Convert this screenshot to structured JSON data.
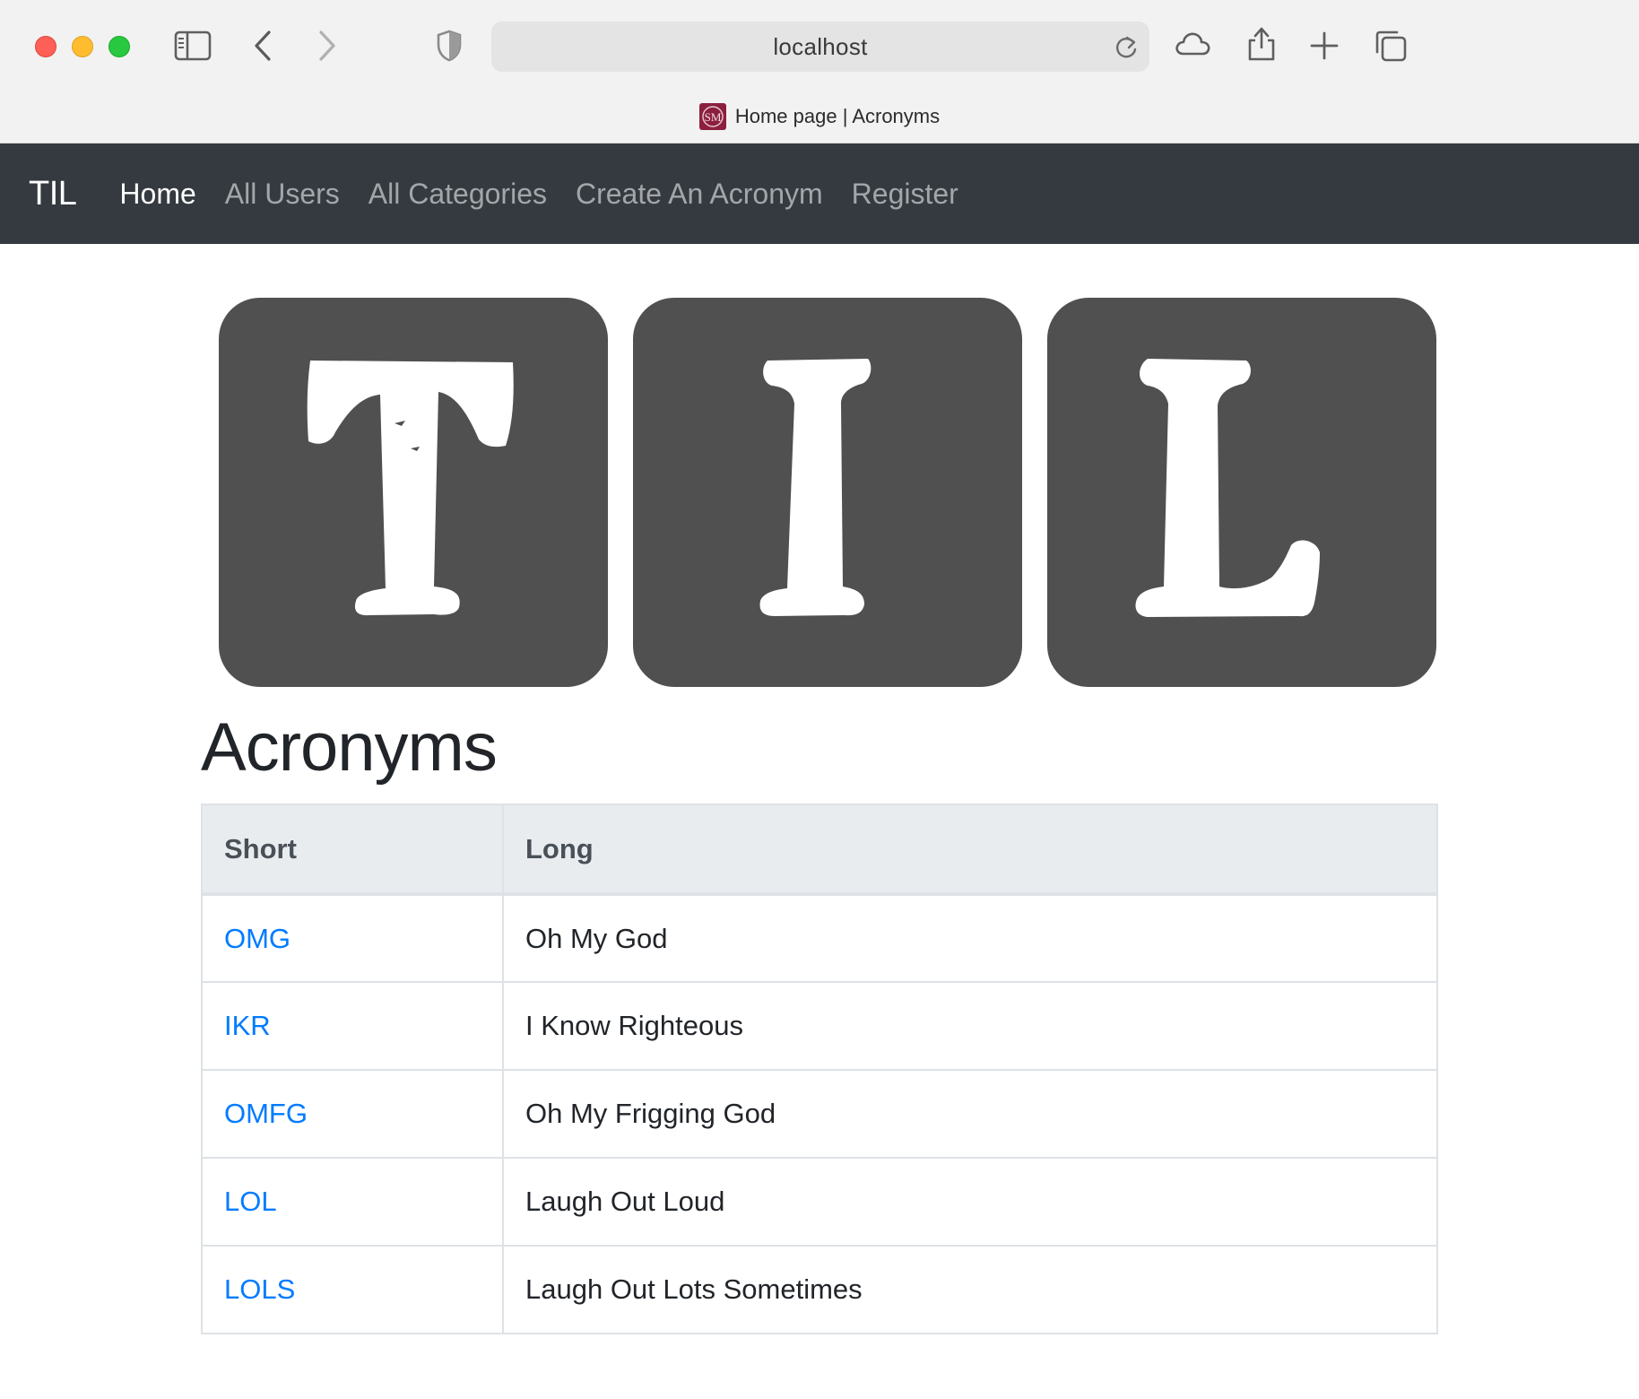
{
  "browser": {
    "url": "localhost",
    "tab_title": "Home page | Acronyms",
    "favicon_text": "SM"
  },
  "navbar": {
    "brand": "TIL",
    "items": [
      {
        "label": "Home",
        "active": true
      },
      {
        "label": "All Users",
        "active": false
      },
      {
        "label": "All Categories",
        "active": false
      },
      {
        "label": "Create An Acronym",
        "active": false
      },
      {
        "label": "Register",
        "active": false
      }
    ]
  },
  "logo": {
    "letters": [
      "T",
      "I",
      "L"
    ],
    "tile_color": "#505050"
  },
  "main": {
    "heading": "Acronyms",
    "table": {
      "headers": [
        "Short",
        "Long"
      ],
      "rows": [
        {
          "short": "OMG",
          "long": "Oh My God"
        },
        {
          "short": "IKR",
          "long": "I Know Righteous"
        },
        {
          "short": "OMFG",
          "long": "Oh My Frigging God"
        },
        {
          "short": "LOL",
          "long": "Laugh Out Loud"
        },
        {
          "short": "LOLS",
          "long": "Laugh Out Lots Sometimes"
        }
      ]
    }
  },
  "colors": {
    "navbar_bg": "#343a40",
    "link": "#007bff",
    "table_header_bg": "#e9ecef"
  }
}
